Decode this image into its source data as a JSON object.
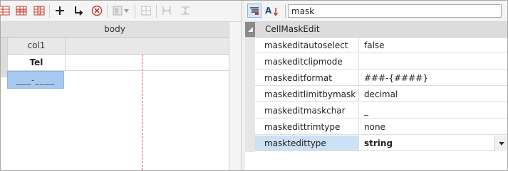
{
  "designer": {
    "toolbar": {
      "icons": [
        "add-head-row-icon",
        "add-body-row-icon",
        "add-column-icon",
        "add-icon",
        "insert-below-icon",
        "delete-icon",
        "merge-cells-icon",
        "split-cells-icon",
        "align-columns-icon",
        "distribute-rows-icon"
      ]
    },
    "band_label": "body",
    "column_header": "col1",
    "cell_value": "Tel",
    "mask_preview": "___-____"
  },
  "property_grid": {
    "search": {
      "value": "mask",
      "placeholder": ""
    },
    "category": "CellMaskEdit",
    "properties": [
      {
        "name": "maskeditautoselect",
        "value": "false"
      },
      {
        "name": "maskeditclipmode",
        "value": ""
      },
      {
        "name": "maskeditformat",
        "value": "###-{####}"
      },
      {
        "name": "maskeditlimitbymask",
        "value": "decimal"
      },
      {
        "name": "maskeditmaskchar",
        "value": "_"
      },
      {
        "name": "maskedittrimtype",
        "value": "none"
      },
      {
        "name": "masktedittype",
        "value": "string"
      }
    ],
    "selected_property": "masktedittype"
  },
  "colors": {
    "selection_blue": "#a7c8f0",
    "selected_row": "#cce0f6",
    "guide_line": "#e05050",
    "icon_red": "#c0392b"
  }
}
